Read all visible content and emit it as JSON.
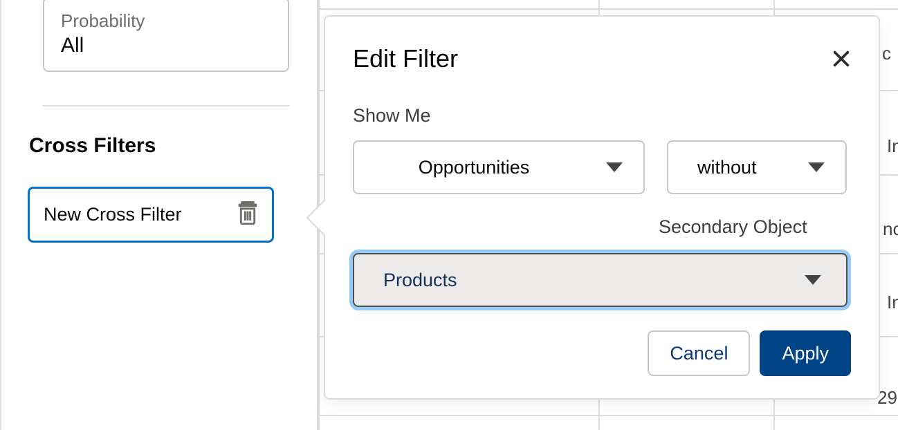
{
  "sidebar": {
    "filter_card": {
      "label": "Probability",
      "value": "All"
    },
    "section_title": "Cross Filters",
    "cross_filter_item": {
      "label": "New Cross Filter"
    }
  },
  "popover": {
    "title": "Edit Filter",
    "show_me_label": "Show Me",
    "primary_object": {
      "value": "Opportunities"
    },
    "relation": {
      "value": "without"
    },
    "secondary_label": "Secondary Object",
    "secondary_object": {
      "value": "Products"
    },
    "cancel_label": "Cancel",
    "apply_label": "Apply"
  },
  "background": {
    "cells": [
      "c",
      "In",
      "nc",
      "In",
      "29"
    ]
  }
}
